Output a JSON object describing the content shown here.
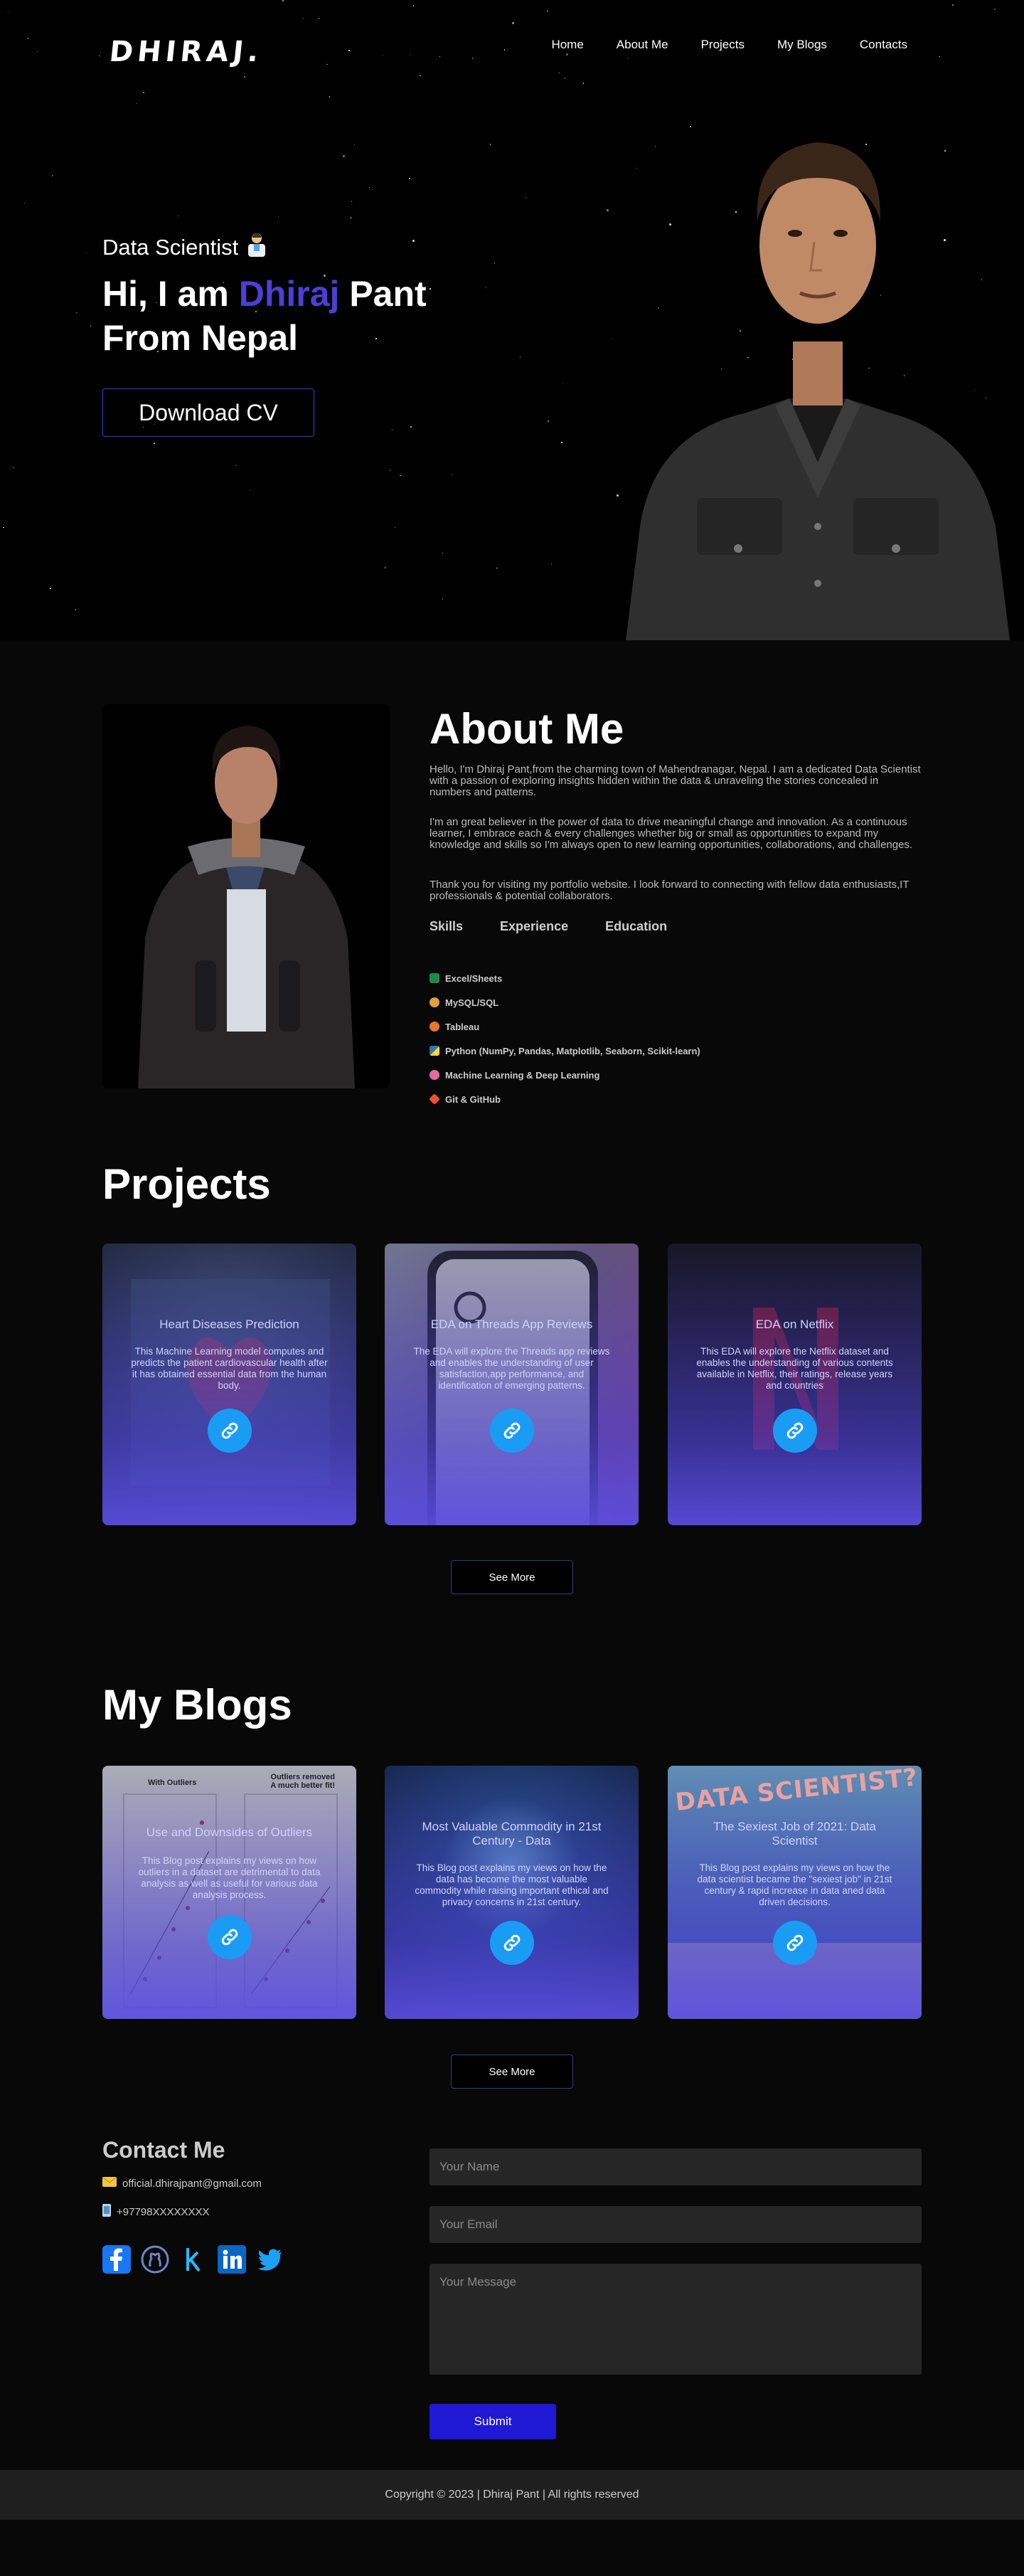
{
  "header": {
    "logo": "DHIRAJ.",
    "nav": [
      "Home",
      "About Me",
      "Projects",
      "My Blogs",
      "Contacts"
    ]
  },
  "hero": {
    "role": "Data Scientist",
    "greeting_prefix": "Hi, I am ",
    "greeting_name": "Dhiraj",
    "greeting_suffix": " Pant",
    "greeting_line2": "From Nepal",
    "cv_button": "Download CV"
  },
  "about": {
    "title": "About Me",
    "paragraphs": [
      "Hello, I'm Dhiraj Pant,from the charming town of Mahendranagar, Nepal. I am a dedicated Data Scientist with a passion of exploring insights hidden within the data & unraveling the stories concealed in numbers and patterns.",
      "I'm an great believer in the power of data to drive meaningful change and innovation. As a continuous learner, I embrace each & every challenges whether big or small as opportunities to expand my knowledge and skills so I'm always open to new learning opportunities, collaborations, and challenges.",
      "Thank you for visiting my portfolio website. I look forward to connecting with fellow data enthusiasts,IT professionals & potential collaborators."
    ],
    "tabs": [
      "Skills",
      "Experience",
      "Education"
    ],
    "skills": [
      {
        "label": "Excel/Sheets",
        "icon": "excel-icon",
        "color": "#1e8a4c"
      },
      {
        "label": "MySQL/SQL",
        "icon": "database-icon",
        "color": "#e0a040"
      },
      {
        "label": "Tableau",
        "icon": "tableau-icon",
        "color": "#e8762c"
      },
      {
        "label": "Python (NumPy, Pandas, Matplotlib, Seaborn, Scikit-learn)",
        "icon": "python-icon",
        "color": "#3776ab"
      },
      {
        "label": "Machine Learning & Deep Learning",
        "icon": "brain-icon",
        "color": "#e06c9f"
      },
      {
        "label": "Git & GitHub",
        "icon": "git-icon",
        "color": "#f05032"
      }
    ]
  },
  "projects": {
    "title": "Projects",
    "items": [
      {
        "title": "Heart Diseases Prediction",
        "description": "This Machine Learning model computes and predicts the patient cardiovascular health after it has obtained essential data from the human body.",
        "link_icon": "link-icon"
      },
      {
        "title": "EDA on Threads App Reviews",
        "description": "The EDA will explore the Threads app reviews and enables the understanding of user satisfaction,app performance, and identification of emerging patterns.",
        "link_icon": "link-icon"
      },
      {
        "title": "EDA on Netflix",
        "description": "This EDA will explore the Netflix dataset and enables the understanding of various contents available in Netflix, their ratings, release years and countries",
        "link_icon": "link-icon"
      }
    ],
    "see_more": "See More"
  },
  "blogs": {
    "title": "My Blogs",
    "items": [
      {
        "title": "Use and Downsides of Outliers",
        "description": "This Blog post explains my views on how outliers in a dataset are detrimental to data analysis as well as useful for various data analysis process.",
        "image_text_left": "With Outliers",
        "image_text_right": "Outliers removed\nA much better fit!"
      },
      {
        "title": "Most Valuable Commodity in 21st Century - Data",
        "description": "This Blog post explains my views on how the data has become the most valuable commodity while raising important ethical and privacy concerns in 21st century."
      },
      {
        "title": "The Sexiest Job of 2021: Data Scientist",
        "description": "This Blog post explains my views on how the data scientist became the \"sexiest job\" in 21st century & rapid increase in data aned data driven decisions.",
        "image_text": "DATA SCIENTIST?"
      }
    ],
    "see_more": "See More"
  },
  "contact": {
    "title": "Contact Me",
    "email": "official.dhirajpant@gmail.com",
    "phone": "+97798XXXXXXXX",
    "socials": [
      "facebook-icon",
      "github-icon",
      "kaggle-icon",
      "linkedin-icon",
      "twitter-icon"
    ],
    "form": {
      "name_placeholder": "Your Name",
      "email_placeholder": "Your Email",
      "message_placeholder": "Your Message",
      "submit": "Submit"
    }
  },
  "footer": {
    "copyright": "Copyright © 2023 | Dhiraj Pant | All rights reserved"
  },
  "colors": {
    "accent": "#4b3fd6",
    "link_button": "#1a9cf5",
    "submit": "#1f18d4"
  }
}
